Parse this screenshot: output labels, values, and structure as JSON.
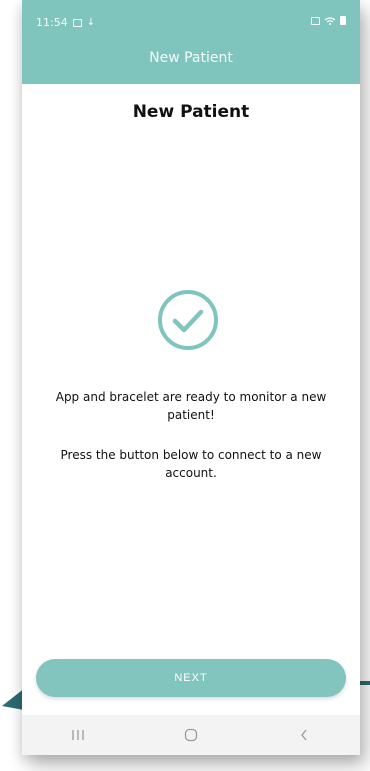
{
  "status_bar": {
    "time": "11:54"
  },
  "app_bar": {
    "title": "New Patient"
  },
  "main": {
    "heading": "New Patient",
    "message_ready": "App and bracelet are ready to monitor a new patient!",
    "message_instruction": "Press the button below to connect to a new account."
  },
  "actions": {
    "next_label": "NEXT"
  },
  "icons": {
    "success": "check-circle-icon",
    "nav_recents": "recents-icon",
    "nav_home": "home-icon",
    "nav_back": "back-icon"
  },
  "colors": {
    "accent": "#7fc4bd",
    "button": "#82c5bf",
    "pointer": "#2d6b72"
  }
}
